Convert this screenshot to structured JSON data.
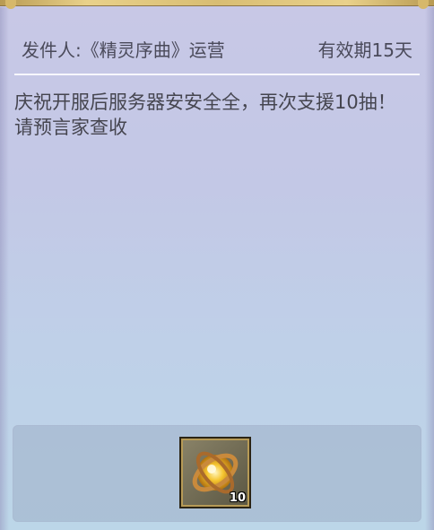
{
  "mail": {
    "sender": "发件人:《精灵序曲》运营",
    "validity": "有效期15天",
    "body": "庆祝开服后服务器安安全全，再次支援10抽！请预言家查收"
  },
  "reward": {
    "icon": "golden-orb-icon",
    "count": "10"
  },
  "colors": {
    "frame_gold": "#d6b86a",
    "text": "#45454f"
  }
}
